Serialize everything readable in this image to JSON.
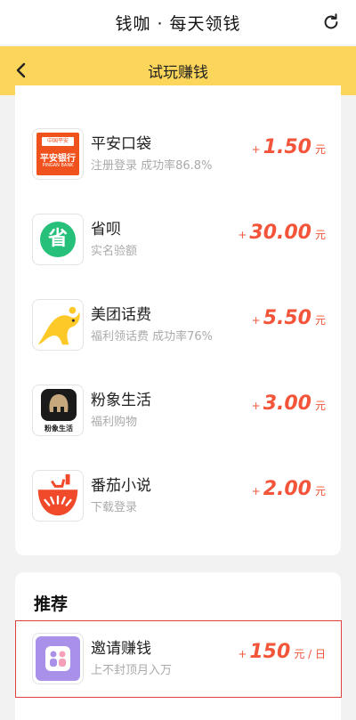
{
  "header": {
    "title": "钱咖 · 每天领钱",
    "refresh_icon": "refresh-icon"
  },
  "nav": {
    "title": "试玩赚钱",
    "back_icon": "chevron-left-icon"
  },
  "tasks": [
    {
      "name": "平安口袋",
      "desc": "注册登录 成功率86.8%",
      "plus": "+",
      "amount": "1.50",
      "unit": "元",
      "icon": "pingan-bank-icon",
      "icon_text_top": "中国平安",
      "icon_text_mid": "平安银行",
      "icon_text_bot": "PINGAN BANK",
      "color": "#f0521e"
    },
    {
      "name": "省呗",
      "desc": "实名验额",
      "plus": "+",
      "amount": "30.00",
      "unit": "元",
      "icon": "shengbei-icon",
      "icon_text": "省",
      "color": "#27c07a"
    },
    {
      "name": "美团话费",
      "desc": "福利领话费 成功率76%",
      "plus": "+",
      "amount": "5.50",
      "unit": "元",
      "icon": "meituan-kangaroo-icon",
      "color": "#fcc928"
    },
    {
      "name": "粉象生活",
      "desc": "福利购物",
      "plus": "+",
      "amount": "3.00",
      "unit": "元",
      "icon": "fenxiang-elephant-icon",
      "icon_text": "粉象生活",
      "color": "#222222"
    },
    {
      "name": "番茄小说",
      "desc": "下载登录",
      "plus": "+",
      "amount": "2.00",
      "unit": "元",
      "icon": "fanqie-tomato-icon",
      "color": "#f04a2a"
    }
  ],
  "recommend": {
    "heading": "推荐",
    "item": {
      "name": "邀请赚钱",
      "desc": "上不封顶月入万",
      "plus": "+",
      "amount": "150",
      "unit": "元 / 日",
      "icon": "invite-people-icon",
      "color": "#a991ea"
    }
  },
  "colors": {
    "accent": "#fcd65a",
    "reward": "#f2553a",
    "highlight": "#e04040"
  }
}
